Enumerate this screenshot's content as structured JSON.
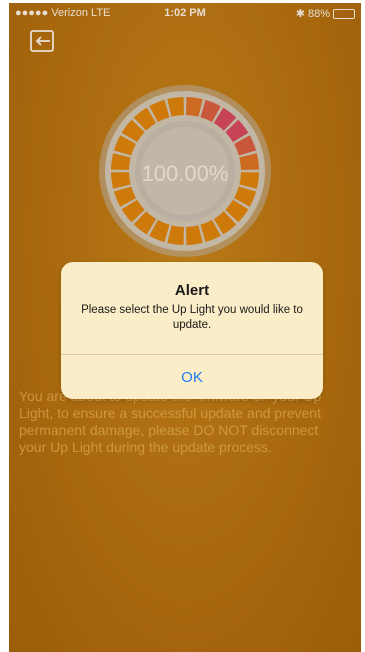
{
  "status_bar": {
    "carrier": "●●●●● Verizon  LTE",
    "time": "1:02 PM",
    "battery": "88%",
    "battery_level": 0.88
  },
  "back_icon": "exit-arrow-icon",
  "gauge": {
    "percent_text": "100.00%",
    "segments": 24,
    "colors": {
      "orange": "#e0860e",
      "pink": "#d6377a",
      "ring": "#c9c9c9"
    }
  },
  "info_text": "You are about to update the firmware on your Up Light, to ensure a successful update and prevent permanent damage, please DO NOT disconnect your Up Light during the update process.",
  "alert": {
    "title": "Alert",
    "message": "Please select the Up Light you would like to update.",
    "ok_label": "OK",
    "accent": "#1d7cf2"
  }
}
